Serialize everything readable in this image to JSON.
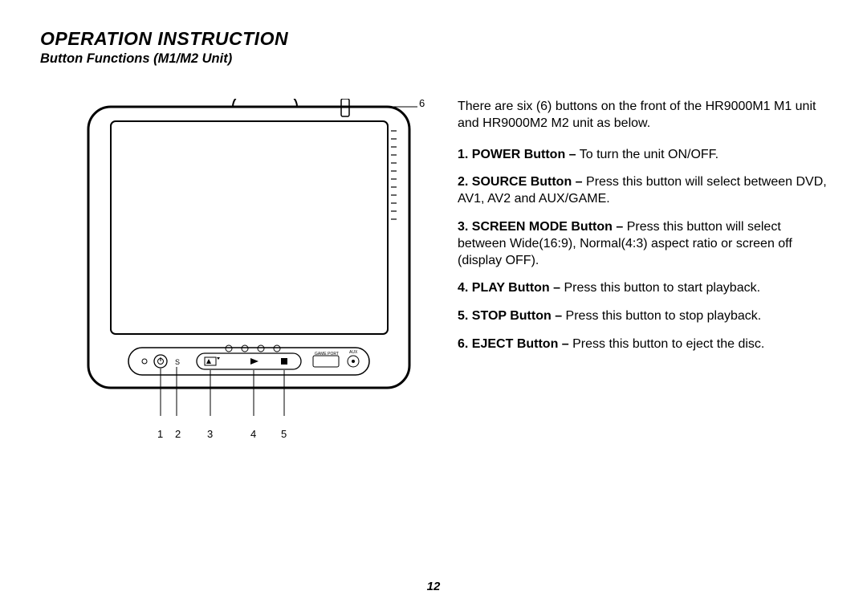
{
  "title": "OPERATION INSTRUCTION",
  "subtitle": "Button Functions (M1/M2 Unit)",
  "intro": "There are six (6) buttons on the front of the HR9000M1 M1 unit and HR9000M2 M2 unit as below.",
  "items": [
    {
      "num": "1.",
      "bold": "POWER Button –",
      "rest": " To turn the unit ON/OFF."
    },
    {
      "num": "2.",
      "bold": "SOURCE Button –",
      "rest": " Press this button will select between DVD, AV1, AV2 and AUX/GAME."
    },
    {
      "num": "3.",
      "bold": "SCREEN MODE Button –",
      "rest": " Press this button will select between Wide(16:9), Normal(4:3) aspect ratio or screen off (display OFF)."
    },
    {
      "num": "4.",
      "bold": "PLAY Button –",
      "rest": " Press this button to start playback."
    },
    {
      "num": "5.",
      "bold": "STOP Button –",
      "rest": " Press this button to stop playback."
    },
    {
      "num": "6.",
      "bold": "EJECT Button –",
      "rest": " Press this button to eject the disc."
    }
  ],
  "callouts": {
    "top": "6",
    "bottom": [
      "1",
      "2",
      "3",
      "4",
      "5"
    ]
  },
  "panel_labels": {
    "game_port": "GAME PORT",
    "aux": "AUX",
    "s": "S"
  },
  "page_number": "12"
}
